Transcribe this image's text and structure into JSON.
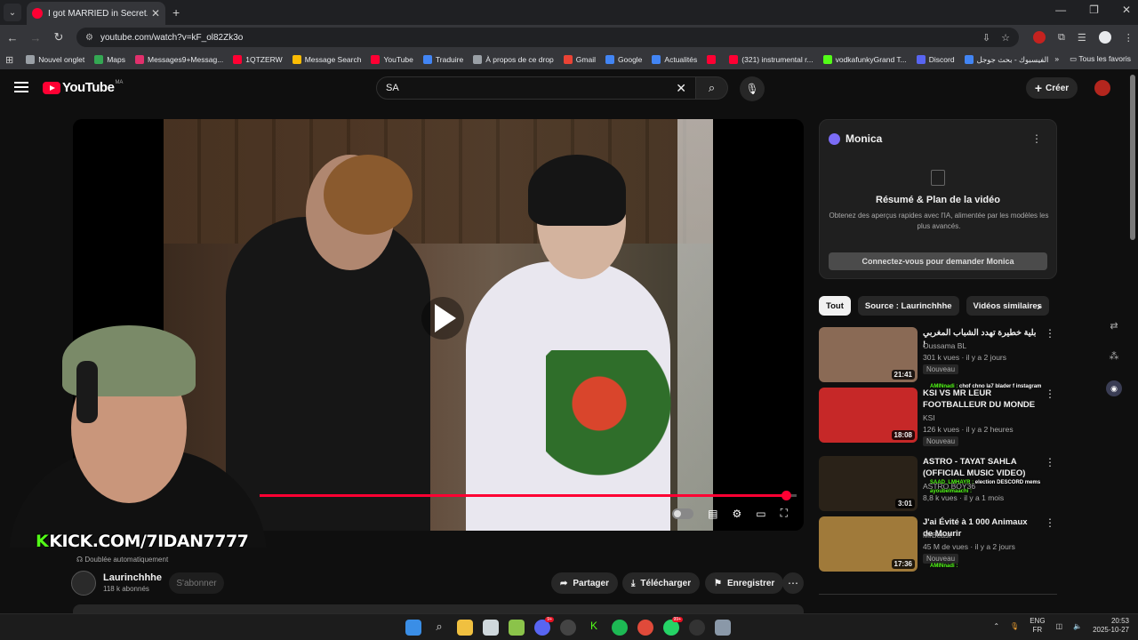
{
  "browser": {
    "tab_title": "I got MARRIED in Secret... - You",
    "url": "youtube.com/watch?v=kF_ol82Zk3o",
    "bookmarks": [
      {
        "label": "Nouvel onglet",
        "color": "#9aa0a6"
      },
      {
        "label": "Maps",
        "color": "#34a853"
      },
      {
        "label": "Messages9+Messag...",
        "color": "#e1306c"
      },
      {
        "label": "1QTZERW",
        "color": "#ff0033"
      },
      {
        "label": "Message Search",
        "color": "#fbbc04"
      },
      {
        "label": "YouTube",
        "color": "#ff0033"
      },
      {
        "label": "Traduire",
        "color": "#4285f4"
      },
      {
        "label": "À propos de ce drop",
        "color": "#9aa0a6"
      },
      {
        "label": "Gmail",
        "color": "#ea4335"
      },
      {
        "label": "Google",
        "color": "#4285f4"
      },
      {
        "label": "Actualités",
        "color": "#4285f4"
      },
      {
        "label": "",
        "color": "#ff0033"
      },
      {
        "label": "(321) instrumental r...",
        "color": "#ff0033"
      },
      {
        "label": "vodkafunkyGrand T...",
        "color": "#53fc18"
      },
      {
        "label": "Discord",
        "color": "#5865f2"
      },
      {
        "label": "الفيسبوك - بحث جوجل",
        "color": "#4285f4"
      }
    ],
    "all_bookmarks": "Tous les favoris"
  },
  "youtube": {
    "logo_text": "YouTube",
    "country_code": "MA",
    "search_value": "SA",
    "create_label": "Créer"
  },
  "player": {
    "progress_fraction": 0.98,
    "stream_overlay": "KICK.COM/7IDAN7777"
  },
  "video_info": {
    "dubbed_label": "Doublée automatiquement",
    "channel_name": "Laurinchhhe",
    "subscribers": "118 k abonnés",
    "subscribe_label": "S'abonner",
    "share_label": "Partager",
    "download_label": "Télécharger",
    "save_label": "Enregistrer"
  },
  "monica": {
    "title": "Monica",
    "heading": "Résumé & Plan de la vidéo",
    "description": "Obtenez des aperçus rapides avec l'IA, alimentée par les modèles les plus avancés.",
    "button": "Connectez-vous pour demander Monica"
  },
  "chips": [
    "Tout",
    "Source : Laurinchhhe",
    "Vidéos similaires"
  ],
  "recommendations": [
    {
      "title": "بلية خطيرة تهدد الشباب المغربي !",
      "channel": "Oussama BL",
      "meta": "301 k vues · il y a 2 jours",
      "badge": "Nouveau",
      "duration": "21:41",
      "thumb": "#8a6a55"
    },
    {
      "title": "KSI VS MR LEUR FOOTBALLEUR DU MONDE DE",
      "channel": "KSI",
      "meta": "126 k vues · il y a 2 heures",
      "badge": "Nouveau",
      "duration": "18:08",
      "thumb": "#c62828"
    },
    {
      "title": "ASTRO - TAYAT SAHLA (OFFICIAL MUSIC VIDEO)",
      "channel": "ASTRO BOY36",
      "meta": "8,8 k vues · il y a 1 mois",
      "badge": "",
      "duration": "3:01",
      "thumb": "#2a2218"
    },
    {
      "title": "J'ai Évité à 1 000 Animaux de Mourir",
      "channel": "MrBeast",
      "meta": "45 M de vues · il y a 2 jours",
      "badge": "Nouveau",
      "duration": "17:36",
      "thumb": "#a07a3a"
    }
  ],
  "chat_lines": [
    {
      "user": "AMINnadi :",
      "msg": "chof chno la7 blader f instagram"
    },
    {
      "user": "SAAD_LMHAYR :",
      "msg": "election DESCORD mems"
    },
    {
      "user": "ayoubelmaachi :",
      "msg": ""
    },
    {
      "user": "AMINnadi :",
      "msg": ""
    }
  ],
  "taskbar": {
    "lang_top": "ENG",
    "lang_bottom": "FR",
    "time": "20:53",
    "date": "2025-10-27",
    "notif_a": "99+"
  }
}
